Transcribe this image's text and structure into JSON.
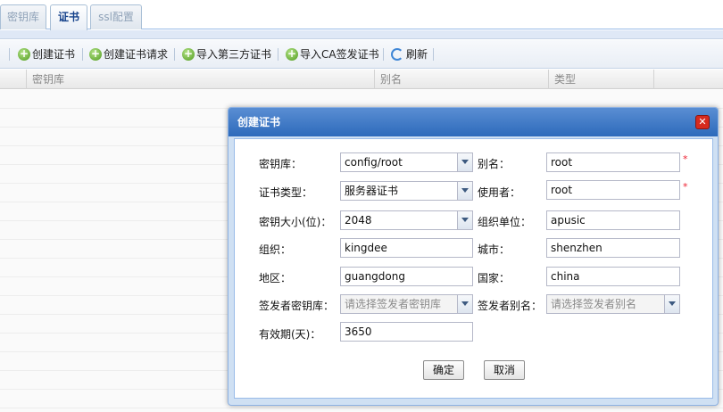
{
  "tabs": [
    {
      "label": "密钥库"
    },
    {
      "label": "证书"
    },
    {
      "label": "ssl配置"
    }
  ],
  "toolbar": {
    "create_cert": "创建证书",
    "create_cert_request": "创建证书请求",
    "import_third_party": "导入第三方证书",
    "import_ca_signed": "导入CA签发证书",
    "refresh": "刷新"
  },
  "grid": {
    "columns": [
      "密钥库",
      "别名",
      "类型"
    ],
    "rows": []
  },
  "dialog": {
    "title": "创建证书",
    "fields": {
      "keystore": {
        "label": "密钥库：",
        "value": "config/root"
      },
      "alias": {
        "label": "别名：",
        "value": "root"
      },
      "cert_type": {
        "label": "证书类型：",
        "value": "服务器证书"
      },
      "user": {
        "label": "使用者：",
        "value": "root"
      },
      "key_size": {
        "label": "密钥大小(位)：",
        "value": "2048"
      },
      "org_unit": {
        "label": "组织单位：",
        "value": "apusic"
      },
      "org": {
        "label": "组织：",
        "value": "kingdee"
      },
      "city": {
        "label": "城市：",
        "value": "shenzhen"
      },
      "region": {
        "label": "地区：",
        "value": "guangdong"
      },
      "country": {
        "label": "国家：",
        "value": "china"
      },
      "issuer_keystore": {
        "label": "签发者密钥库：",
        "placeholder": "请选择签发者密钥库"
      },
      "issuer_alias": {
        "label": "签发者别名：",
        "placeholder": "请选择签发者别名"
      },
      "validity": {
        "label": "有效期(天)：",
        "value": "3650"
      }
    },
    "required_mark": "*",
    "ok": "确定",
    "cancel": "取消"
  }
}
